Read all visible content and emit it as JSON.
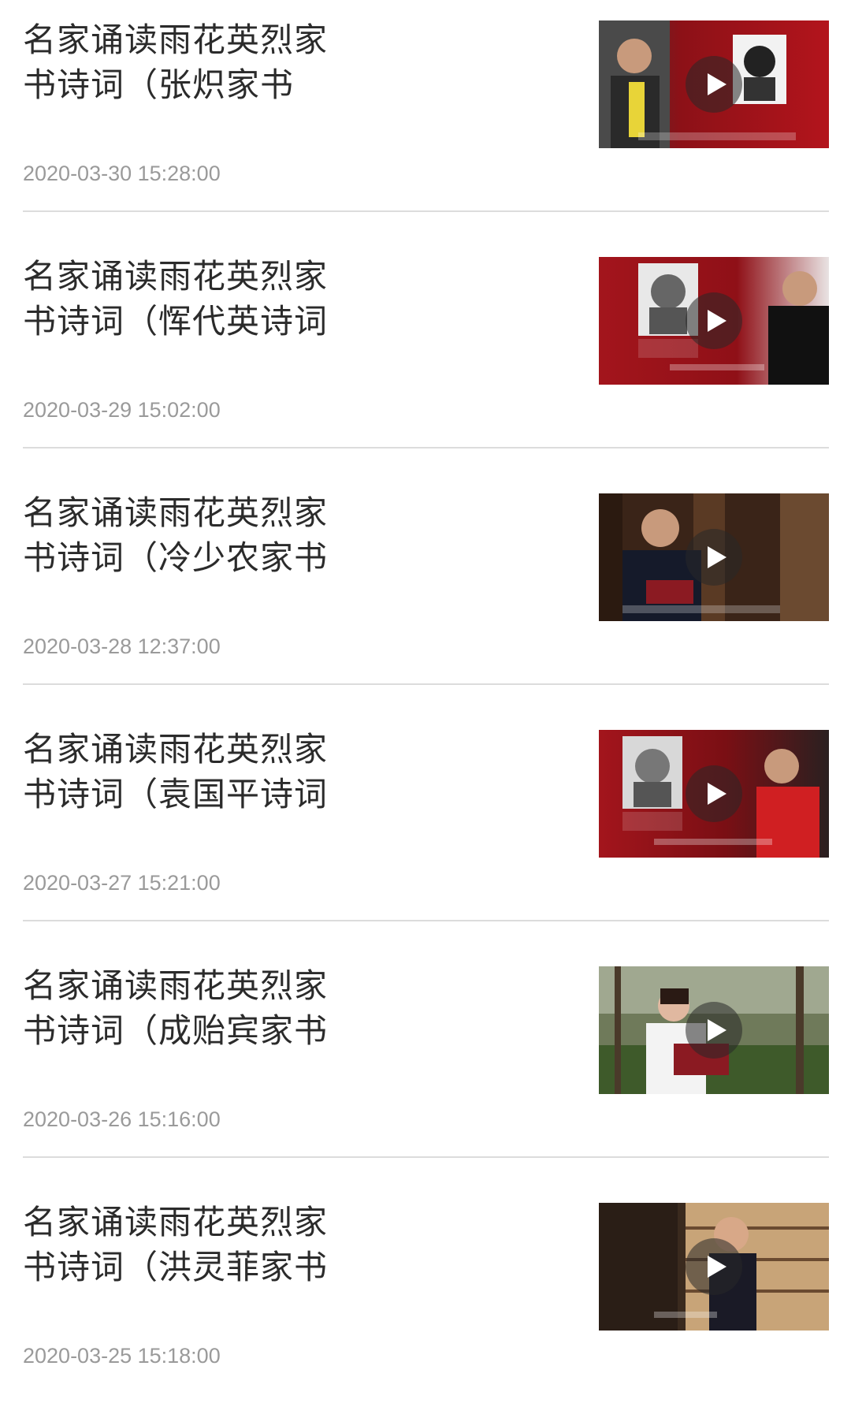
{
  "items": [
    {
      "title": "名家诵读雨花英烈家\n书诗词（张炽家书",
      "date": "2020-03-30 15:28:00"
    },
    {
      "title": "名家诵读雨花英烈家\n书诗词（恽代英诗词",
      "date": "2020-03-29 15:02:00"
    },
    {
      "title": "名家诵读雨花英烈家\n书诗词（冷少农家书",
      "date": "2020-03-28 12:37:00"
    },
    {
      "title": "名家诵读雨花英烈家\n书诗词（袁国平诗词",
      "date": "2020-03-27 15:21:00"
    },
    {
      "title": "名家诵读雨花英烈家\n书诗词（成贻宾家书",
      "date": "2020-03-26 15:16:00"
    },
    {
      "title": "名家诵读雨花英烈家\n书诗词（洪灵菲家书",
      "date": "2020-03-25 15:18:00"
    }
  ],
  "colors": {
    "title": "#2b2b2b",
    "date": "#9a9a9a",
    "divider": "#dcdcdc",
    "thumb_red": "#9b1218"
  },
  "icons": {
    "play": "play-icon"
  }
}
